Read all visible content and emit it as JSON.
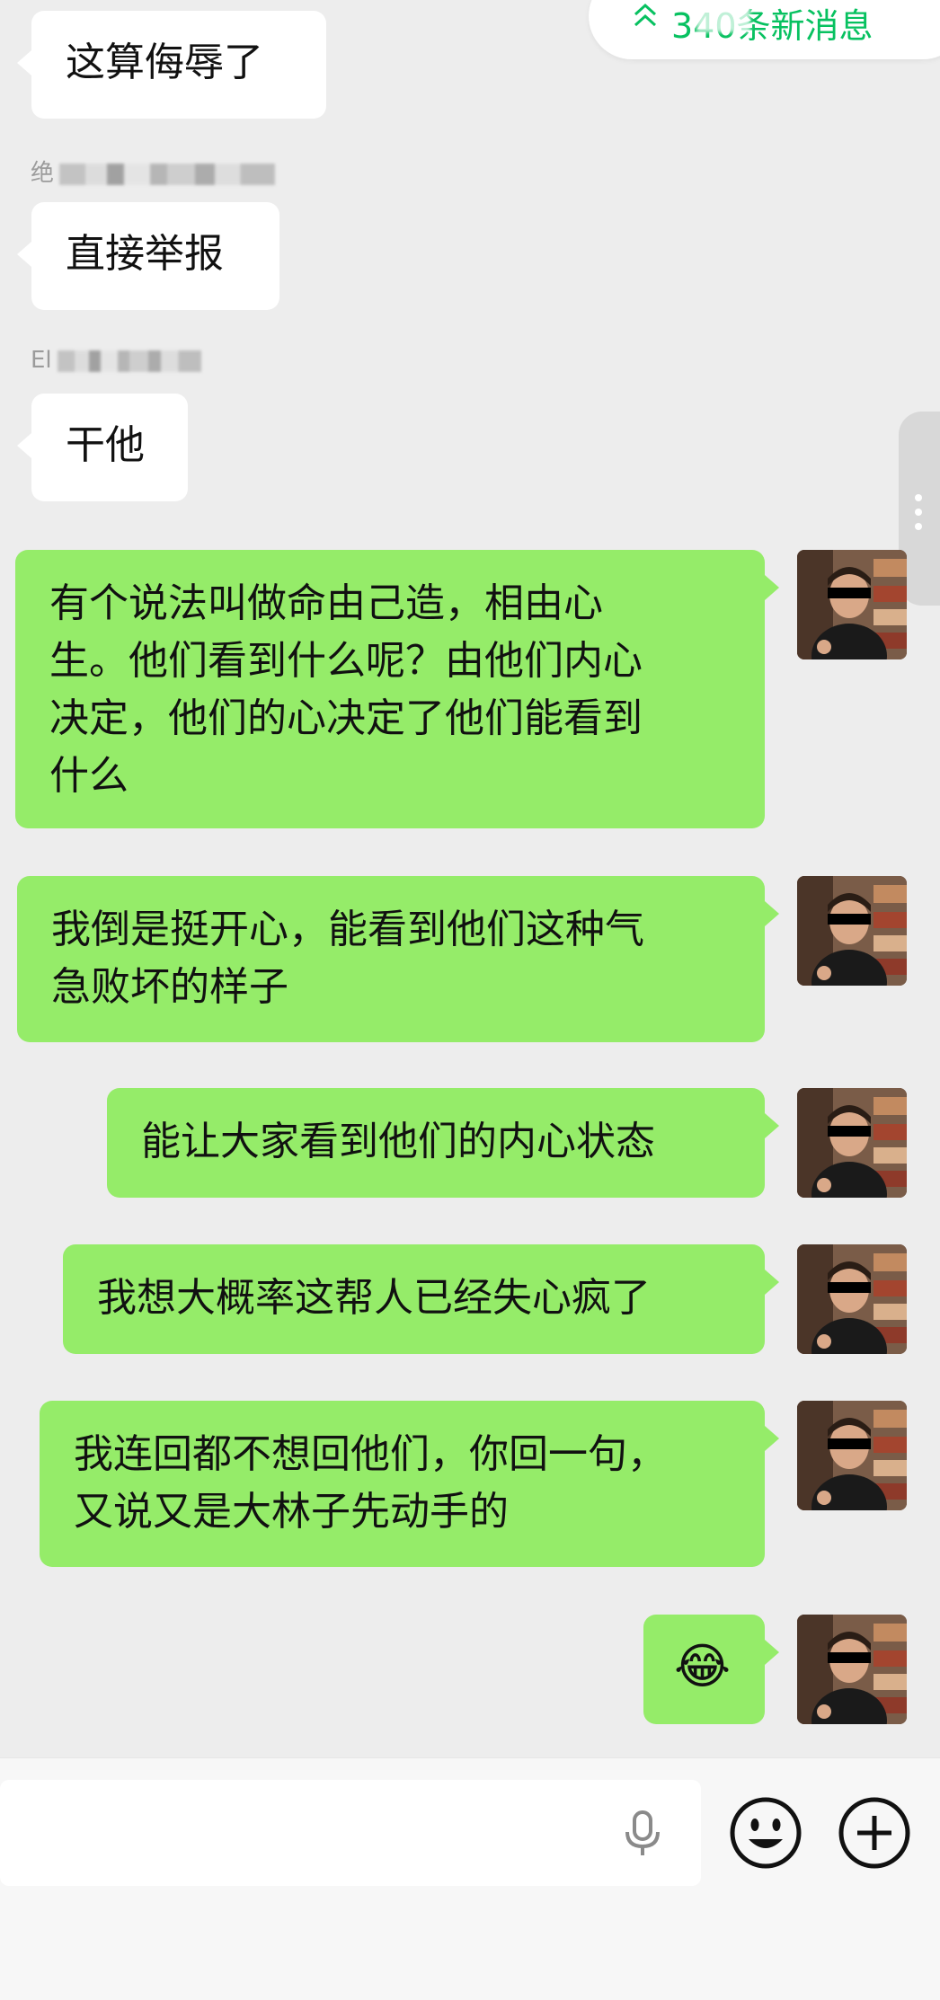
{
  "unread": {
    "text": "340条新消息"
  },
  "messages": [
    {
      "side": "left",
      "text": "这算侮辱了"
    },
    {
      "side": "left",
      "sender": "绝",
      "text": "直接举报"
    },
    {
      "side": "left",
      "sender": "El",
      "text": "干他"
    },
    {
      "side": "right",
      "text": "有个说法叫做命由己造，相由心\n生。他们看到什么呢？由他们内心\n决定，他们的心决定了他们能看到\n什么"
    },
    {
      "side": "right",
      "text": "我倒是挺开心，能看到他们这种气\n急败坏的样子"
    },
    {
      "side": "right",
      "text": "能让大家看到他们的内心状态"
    },
    {
      "side": "right",
      "text": "我想大概率这帮人已经失心疯了"
    },
    {
      "side": "right",
      "text": "我连回都不想回他们，你回一句，\n又说又是大林子先动手的"
    },
    {
      "side": "right",
      "text": "😂"
    }
  ],
  "icons": {
    "unread_chevron": "double-chevron-up-icon",
    "mic": "microphone-icon",
    "emoji": "smiley-face-icon",
    "plus": "plus-circle-icon",
    "side_menu": "vertical-dots-icon"
  },
  "colors": {
    "background": "#ededed",
    "bubble_self": "#95ec69",
    "bubble_other": "#ffffff",
    "unread_text": "#07c160"
  }
}
